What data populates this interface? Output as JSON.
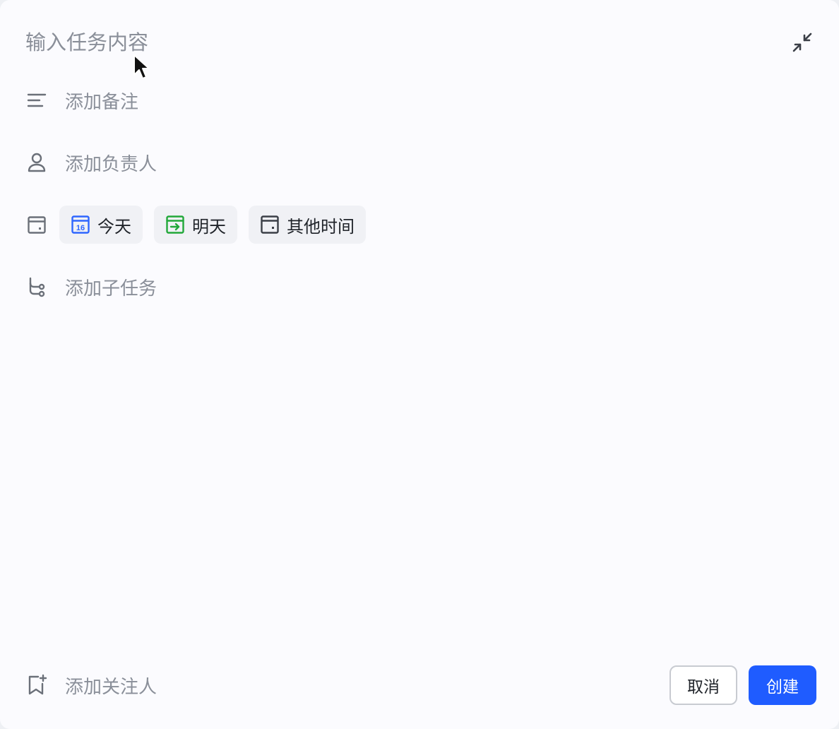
{
  "title_input": {
    "placeholder": "输入任务内容",
    "value": ""
  },
  "rows": {
    "note": {
      "label": "添加备注",
      "icon": "text-lines-icon"
    },
    "assignee": {
      "label": "添加负责人",
      "icon": "person-icon"
    },
    "date": {
      "icon": "calendar-icon"
    },
    "subtask": {
      "label": "添加子任务",
      "icon": "subtask-icon"
    },
    "follower": {
      "label": "添加关注人",
      "icon": "bookmark-add-icon"
    }
  },
  "date_chips": [
    {
      "label": "今天",
      "icon": "calendar-today-icon",
      "icon_text": "16",
      "color": "#2f66ff"
    },
    {
      "label": "明天",
      "icon": "calendar-tomorrow-icon",
      "color": "#22a83a"
    },
    {
      "label": "其他时间",
      "icon": "calendar-other-icon",
      "color": "#3b3f47"
    }
  ],
  "buttons": {
    "cancel": "取消",
    "create": "创建"
  },
  "colors": {
    "accent": "#1f5cff",
    "today": "#2f66ff",
    "tomorrow": "#22a83a",
    "muted_text": "#8a8f99"
  }
}
